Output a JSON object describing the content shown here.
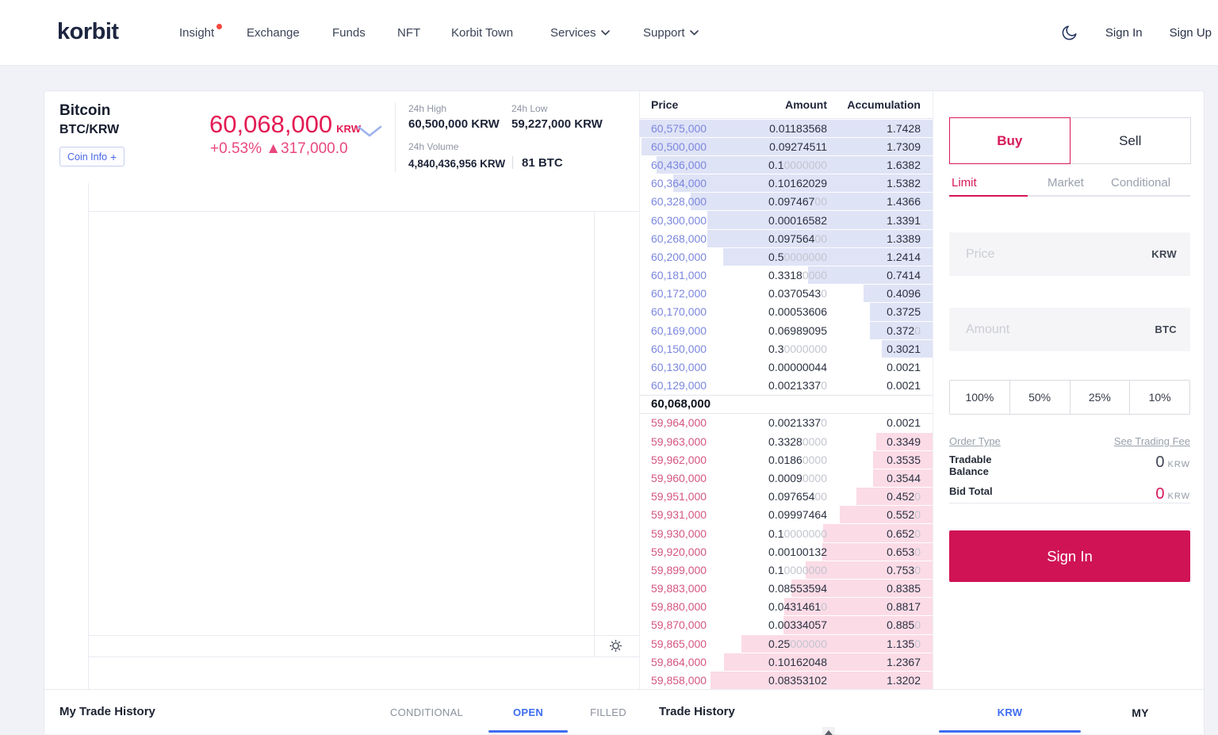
{
  "colors": {
    "accent": "#d6185a",
    "price_red": "#e31b54",
    "ask_text": "#7b87de",
    "ask_bar": "#dfe3f6",
    "bid_text": "#d4567f",
    "bid_bar": "#fbdbe6",
    "tab_blue": "#3e6cf0"
  },
  "header": {
    "logo": "korbit",
    "nav": [
      {
        "label": "Insight"
      },
      {
        "label": "Exchange"
      },
      {
        "label": "Funds"
      },
      {
        "label": "NFT"
      },
      {
        "label": "Korbit Town"
      },
      {
        "label": "Services"
      },
      {
        "label": "Support"
      }
    ],
    "sign_in": "Sign In",
    "sign_up": "Sign Up"
  },
  "ticker": {
    "name": "Bitcoin",
    "pair": "BTC/KRW",
    "coin_info": "Coin Info",
    "price": "60,068,000",
    "price_unit": "KRW",
    "change": "+0.53% ▲317,000.0",
    "high_label": "24h High",
    "high_value": "60,500,000 KRW",
    "low_label": "24h Low",
    "low_value": "59,227,000 KRW",
    "volume_label": "24h Volume",
    "volume_krw": "4,840,436,956 KRW",
    "volume_btc": "81 BTC"
  },
  "orderbook": {
    "headers": {
      "price": "Price",
      "amount": "Amount",
      "accumulation": "Accumulation"
    },
    "current_price": "60,068,000",
    "asks": [
      {
        "price": "60,575,000",
        "amount": "0.01183568",
        "amount_pad": "",
        "acc": "1.7428",
        "acc_pad": ""
      },
      {
        "price": "60,500,000",
        "amount": "0.09274511",
        "amount_pad": "",
        "acc": "1.7309",
        "acc_pad": ""
      },
      {
        "price": "60,436,000",
        "amount": "0.1",
        "amount_pad": "0000000",
        "acc": "1.6382",
        "acc_pad": ""
      },
      {
        "price": "60,364,000",
        "amount": "0.10162029",
        "amount_pad": "",
        "acc": "1.5382",
        "acc_pad": ""
      },
      {
        "price": "60,328,000",
        "amount": "0.097467",
        "amount_pad": "00",
        "acc": "1.4366",
        "acc_pad": ""
      },
      {
        "price": "60,300,000",
        "amount": "0.00016582",
        "amount_pad": "",
        "acc": "1.3391",
        "acc_pad": ""
      },
      {
        "price": "60,268,000",
        "amount": "0.097564",
        "amount_pad": "00",
        "acc": "1.3389",
        "acc_pad": ""
      },
      {
        "price": "60,200,000",
        "amount": "0.5",
        "amount_pad": "0000000",
        "acc": "1.2414",
        "acc_pad": ""
      },
      {
        "price": "60,181,000",
        "amount": "0.3318",
        "amount_pad": "0000",
        "acc": "0.7414",
        "acc_pad": ""
      },
      {
        "price": "60,172,000",
        "amount": "0.0370543",
        "amount_pad": "0",
        "acc": "0.4096",
        "acc_pad": ""
      },
      {
        "price": "60,170,000",
        "amount": "0.00053606",
        "amount_pad": "",
        "acc": "0.3725",
        "acc_pad": ""
      },
      {
        "price": "60,169,000",
        "amount": "0.06989095",
        "amount_pad": "",
        "acc": "0.372",
        "acc_pad": "0"
      },
      {
        "price": "60,150,000",
        "amount": "0.3",
        "amount_pad": "0000000",
        "acc": "0.3021",
        "acc_pad": ""
      },
      {
        "price": "60,130,000",
        "amount": "0.00000044",
        "amount_pad": "",
        "acc": "0.0021",
        "acc_pad": ""
      },
      {
        "price": "60,129,000",
        "amount": "0.0021337",
        "amount_pad": "0",
        "acc": "0.0021",
        "acc_pad": ""
      }
    ],
    "bids": [
      {
        "price": "59,964,000",
        "amount": "0.0021337",
        "amount_pad": "0",
        "acc": "0.0021",
        "acc_pad": ""
      },
      {
        "price": "59,963,000",
        "amount": "0.3328",
        "amount_pad": "0000",
        "acc": "0.3349",
        "acc_pad": ""
      },
      {
        "price": "59,962,000",
        "amount": "0.0186",
        "amount_pad": "0000",
        "acc": "0.3535",
        "acc_pad": ""
      },
      {
        "price": "59,960,000",
        "amount": "0.0009",
        "amount_pad": "0000",
        "acc": "0.3544",
        "acc_pad": ""
      },
      {
        "price": "59,951,000",
        "amount": "0.097654",
        "amount_pad": "00",
        "acc": "0.452",
        "acc_pad": "0"
      },
      {
        "price": "59,931,000",
        "amount": "0.09997464",
        "amount_pad": "",
        "acc": "0.552",
        "acc_pad": "0"
      },
      {
        "price": "59,930,000",
        "amount": "0.1",
        "amount_pad": "0000000",
        "acc": "0.652",
        "acc_pad": "0"
      },
      {
        "price": "59,920,000",
        "amount": "0.00100132",
        "amount_pad": "",
        "acc": "0.653",
        "acc_pad": "0"
      },
      {
        "price": "59,899,000",
        "amount": "0.1",
        "amount_pad": "0000000",
        "acc": "0.753",
        "acc_pad": "0"
      },
      {
        "price": "59,883,000",
        "amount": "0.08553594",
        "amount_pad": "",
        "acc": "0.8385",
        "acc_pad": ""
      },
      {
        "price": "59,880,000",
        "amount": "0.0431461",
        "amount_pad": "0",
        "acc": "0.8817",
        "acc_pad": ""
      },
      {
        "price": "59,870,000",
        "amount": "0.00334057",
        "amount_pad": "",
        "acc": "0.885",
        "acc_pad": "0"
      },
      {
        "price": "59,865,000",
        "amount": "0.25",
        "amount_pad": "000000",
        "acc": "1.135",
        "acc_pad": "0"
      },
      {
        "price": "59,864,000",
        "amount": "0.10162048",
        "amount_pad": "",
        "acc": "1.2367",
        "acc_pad": ""
      },
      {
        "price": "59,858,000",
        "amount": "0.08353102",
        "amount_pad": "",
        "acc": "1.3202",
        "acc_pad": ""
      }
    ]
  },
  "order_panel": {
    "buy": "Buy",
    "sell": "Sell",
    "type_tabs": [
      "Limit",
      "Market",
      "Conditional"
    ],
    "price_placeholder": "Price",
    "price_unit": "KRW",
    "amount_placeholder": "Amount",
    "amount_unit": "BTC",
    "percent_options": [
      "100%",
      "50%",
      "25%",
      "10%"
    ],
    "order_type_link": "Order Type",
    "fee_link": "See Trading Fee",
    "tradable_label_1": "Tradable",
    "tradable_label_2": "Balance",
    "tradable_value": "0",
    "tradable_unit": "KRW",
    "bid_total_label": "Bid Total",
    "bid_total_value": "0",
    "bid_total_unit": "KRW",
    "sign_in_button": "Sign In"
  },
  "bottom_bar": {
    "left_title": "My Trade History",
    "tab_conditional": "CONDITIONAL",
    "tab_open": "OPEN",
    "tab_filled": "FILLED",
    "mid_title": "Trade History",
    "tab_krw": "KRW",
    "tab_my": "MY"
  }
}
